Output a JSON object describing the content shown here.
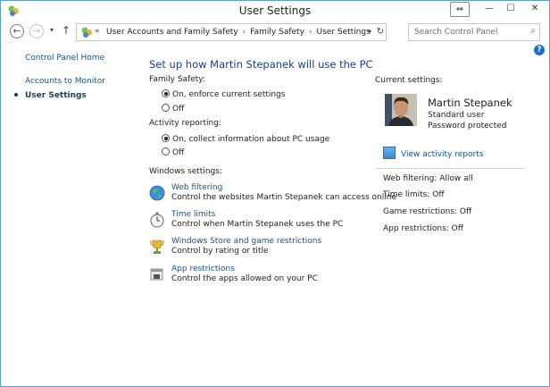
{
  "window": {
    "title": "User Settings"
  },
  "nav": {
    "breadcrumb": [
      "User Accounts and Family Safety",
      "Family Safety",
      "User Settings"
    ],
    "search_placeholder": "Search Control Panel"
  },
  "sidebar": {
    "items": [
      {
        "label": "Control Panel Home"
      },
      {
        "label": "Accounts to Monitor"
      },
      {
        "label": "User Settings"
      }
    ]
  },
  "main": {
    "heading": "Set up how Martin Stepanek will use the PC",
    "family_safety": {
      "label": "Family Safety:",
      "options": [
        {
          "label": "On, enforce current settings",
          "selected": true
        },
        {
          "label": "Off",
          "selected": false
        }
      ]
    },
    "activity_reporting": {
      "label": "Activity reporting:",
      "options": [
        {
          "label": "On, collect information about PC usage",
          "selected": true
        },
        {
          "label": "Off",
          "selected": false
        }
      ]
    },
    "windows_settings": {
      "label": "Windows settings:",
      "items": [
        {
          "title": "Web filtering",
          "desc": "Control the websites Martin Stepanek can access online",
          "icon": "globe-icon"
        },
        {
          "title": "Time limits",
          "desc": "Control when Martin Stepanek uses the PC",
          "icon": "stopwatch-icon"
        },
        {
          "title": "Windows Store and game restrictions",
          "desc": "Control by rating or title",
          "icon": "trophy-icon"
        },
        {
          "title": "App restrictions",
          "desc": "Control the apps allowed on your PC",
          "icon": "app-icon"
        }
      ]
    }
  },
  "current": {
    "title": "Current settings:",
    "user_name": "Martin Stepanek",
    "user_type": "Standard user",
    "password": "Password protected",
    "activity_link": "View activity reports",
    "stats": [
      "Web filtering: Allow all",
      "Time limits: Off",
      "Game restrictions: Off",
      "App restrictions: Off"
    ]
  }
}
